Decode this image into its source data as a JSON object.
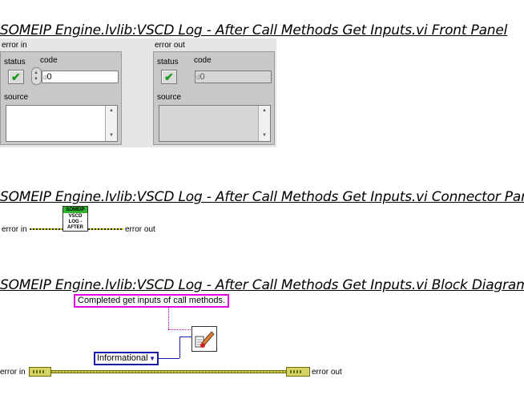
{
  "front_panel": {
    "heading": "SOMEIP Engine.lvlib:VSCD Log - After Call Methods Get Inputs.vi Front Panel",
    "error_in": {
      "title": "error in",
      "status_label": "status",
      "code_label": "code",
      "code_prefix": "d",
      "code_value": "0",
      "source_label": "source",
      "status_icon": "green-checkmark"
    },
    "error_out": {
      "title": "error out",
      "status_label": "status",
      "code_label": "code",
      "code_prefix": "d",
      "code_value": "0",
      "source_label": "source",
      "status_icon": "green-checkmark"
    }
  },
  "connector_pane": {
    "heading": "SOMEIP Engine.lvlib:VSCD Log - After Call Methods Get Inputs.vi Connector Pane",
    "left_terminal": "error in",
    "right_terminal": "error out",
    "icon_banner": "SOMEIP",
    "icon_lines": [
      "VSCD",
      "LOG -",
      "AFTER"
    ]
  },
  "block_diagram": {
    "heading": "SOMEIP Engine.lvlib:VSCD Log - After Call Methods Get Inputs.vi Block Diagram",
    "string_constant": "Completed get inputs of call methods.",
    "enum_constant": "Informational",
    "left_terminal": "error in",
    "right_terminal": "error out",
    "log_icon": "pencil-log-icon"
  },
  "colors": {
    "error_cluster": "#c8c800",
    "string_wire": "#e000e0",
    "enum_wire": "#1a1aa8",
    "status_ok": "#1a9b1a"
  }
}
